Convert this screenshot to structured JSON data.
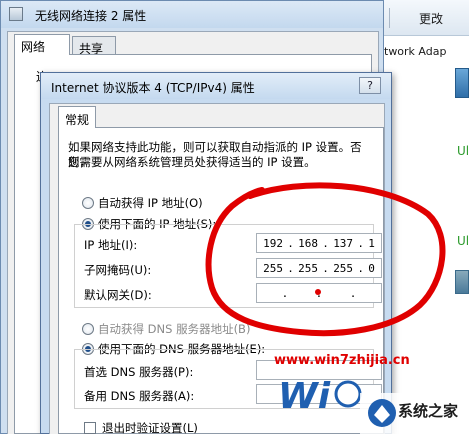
{
  "background_window": {
    "toolbar_button": "更改",
    "adapter_name": "twork Adap",
    "status_1": "Ul",
    "status_2": "Ul"
  },
  "outer_dialog": {
    "title": "无线网络连接 2 属性",
    "tabs": [
      "网络",
      "共享"
    ],
    "connect_label": "连"
  },
  "inner_dialog": {
    "title": "Internet 协议版本 4 (TCP/IPv4) 属性",
    "help_button": "?",
    "tab": "常规",
    "description_line1": "如果网络支持此功能，则可以获取自动指派的 IP 设置。否则，",
    "description_line2": "您需要从网络系统管理员处获得适当的 IP 设置。",
    "ip_auto_label": "自动获得 IP 地址(O)",
    "ip_manual_label": "使用下面的 IP 地址(S):",
    "ip_address_label": "IP 地址(I):",
    "ip_address": [
      "192",
      "168",
      "137",
      "1"
    ],
    "subnet_label": "子网掩码(U):",
    "subnet_mask": [
      "255",
      "255",
      "255",
      "0"
    ],
    "gateway_label": "默认网关(D):",
    "gateway": [
      "",
      "",
      "",
      ""
    ],
    "dns_auto_label": "自动获得 DNS 服务器地址(B)",
    "dns_manual_label": "使用下面的 DNS 服务器地址(E):",
    "dns_preferred_label": "首选 DNS 服务器(P):",
    "dns_alternate_label": "备用 DNS 服务器(A):",
    "validate_label": "退出时验证设置(L)"
  },
  "watermark": {
    "url": "www.win7zhijia.cn",
    "site_name": "系统之家"
  },
  "colors": {
    "annotation_circle": "#e00000",
    "title_bar": "#c4d9ef",
    "status_green": "#2a9a2a"
  }
}
